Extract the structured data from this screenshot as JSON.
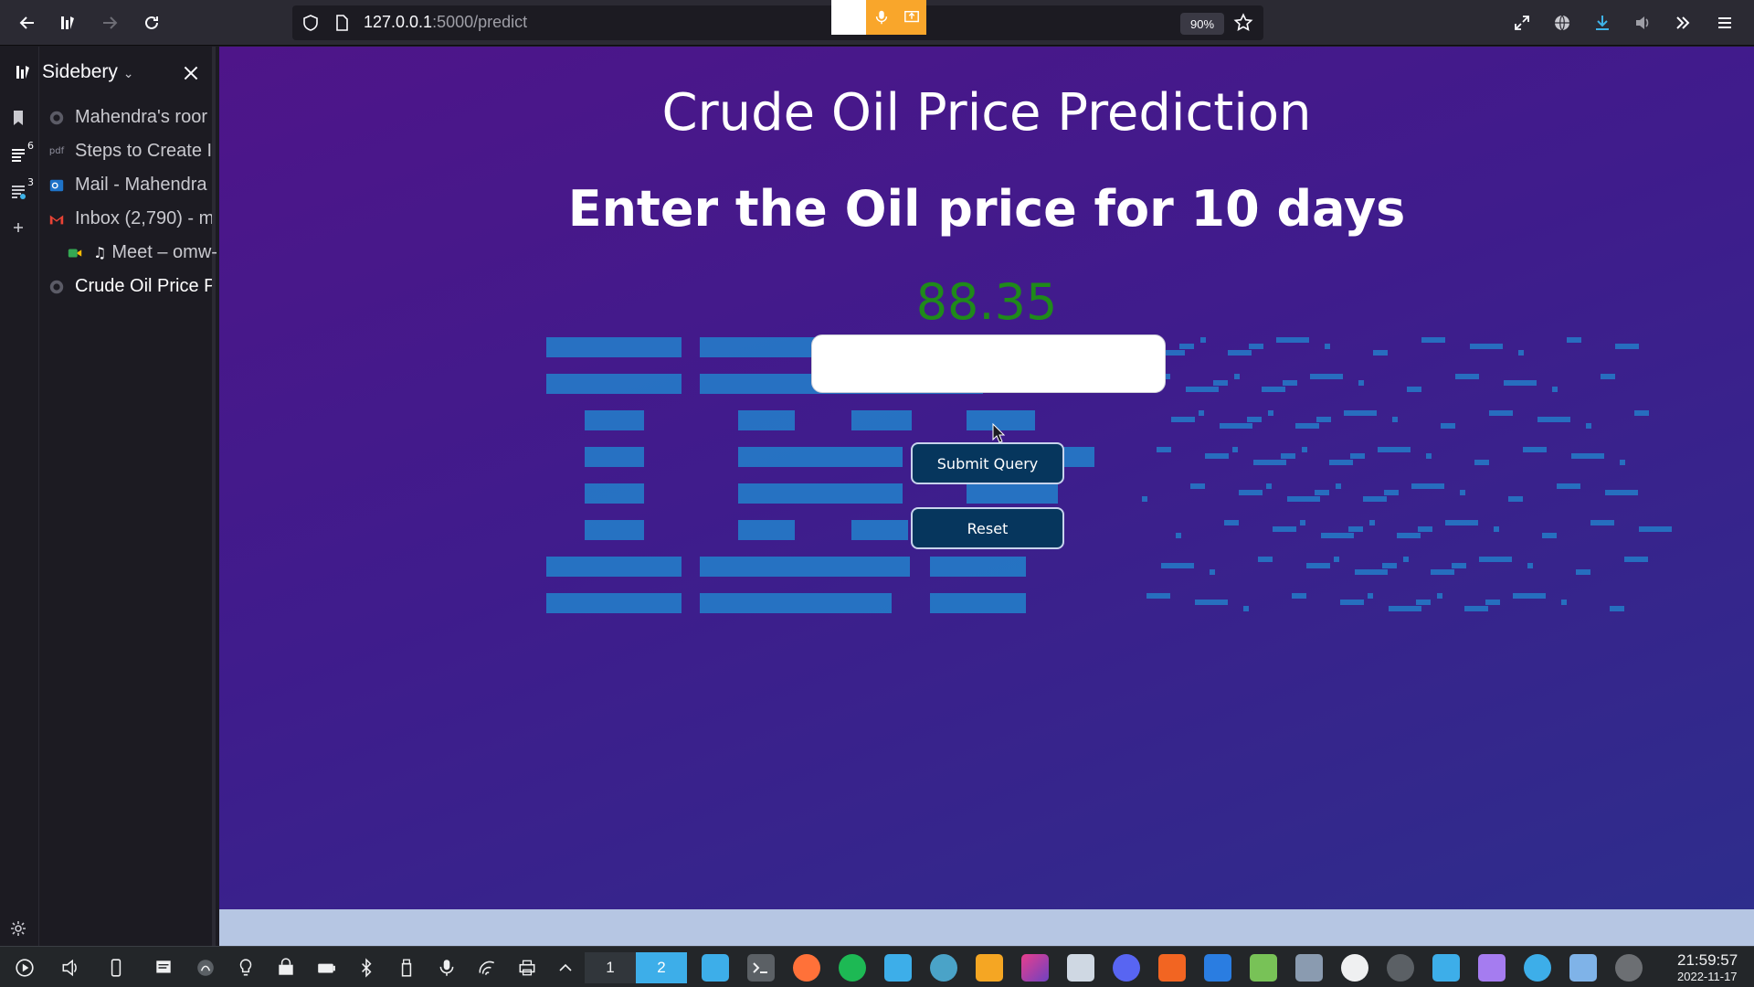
{
  "browser": {
    "url_host": "127.0.0.1",
    "url_path": ":5000/predict",
    "zoom": "90%"
  },
  "sidebar": {
    "title": "Sidebery",
    "panel_counts": [
      "6",
      "3"
    ],
    "tabs": [
      {
        "label": "Mahendra's roor",
        "favicon": "loading-icon"
      },
      {
        "label": "Steps to Create I",
        "favicon": "pdf-icon",
        "favicon_text": "pdf"
      },
      {
        "label": "Mail - Mahendra",
        "favicon": "outlook-icon"
      },
      {
        "label": "Inbox (2,790) - m",
        "favicon": "gmail-icon"
      },
      {
        "label": "Meet – omw-",
        "favicon": "meet-icon"
      },
      {
        "label": "Crude Oil Price P",
        "favicon": "loading-icon"
      }
    ]
  },
  "page": {
    "title": "Crude Oil Price Prediction",
    "subtitle": "Enter the Oil price for 10 days",
    "prediction": "88.35",
    "input_value": "",
    "submit_label": "Submit Query",
    "reset_label": "Reset",
    "colors": {
      "prediction": "#1f8a1a",
      "button_bg": "#06365d",
      "logo": "#1f8fd4"
    }
  },
  "taskbar": {
    "desktops": [
      "1",
      "2"
    ],
    "time": "21:59:57",
    "date": "2022-11-17"
  }
}
